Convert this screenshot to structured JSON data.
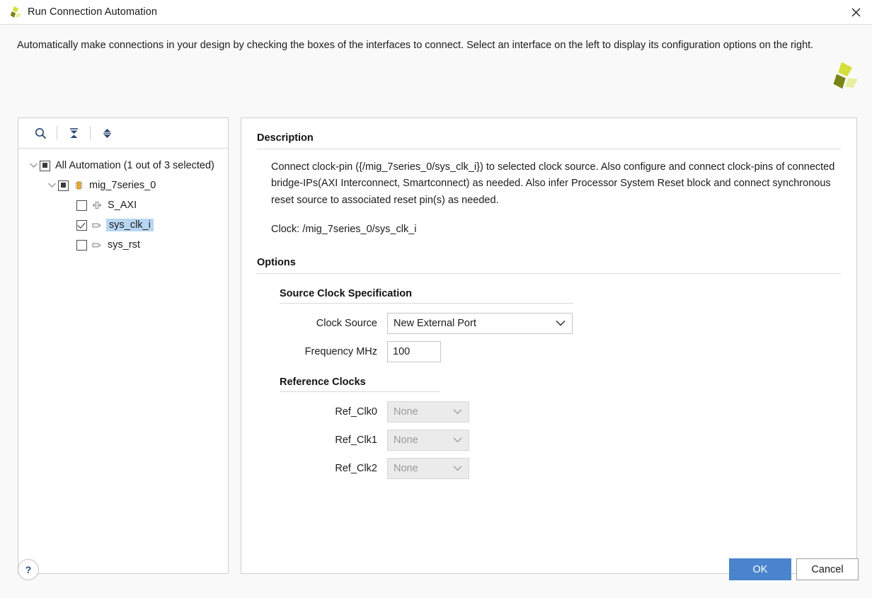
{
  "window": {
    "title": "Run Connection Automation",
    "logo_icon": "vivado-logo-icon",
    "close_icon": "close-icon"
  },
  "intro": {
    "text": "Automatically make connections in your design by checking the boxes of the interfaces to connect. Select an interface on the left to display its configuration options on the right.",
    "logo_icon": "vivado-logo-icon"
  },
  "tree_toolbar": {
    "search_icon": "search-icon",
    "collapse_all_icon": "collapse-all-icon",
    "expand_all_icon": "expand-all-icon"
  },
  "tree": {
    "nodes": [
      {
        "label": "All Automation (1 out of 3 selected)",
        "check_state": "partial",
        "expanded": true,
        "indent": 0,
        "has_twisty": true,
        "icon": "none",
        "selected": false
      },
      {
        "label": "mig_7series_0",
        "check_state": "partial",
        "expanded": true,
        "indent": 1,
        "has_twisty": true,
        "icon": "ip-block-icon",
        "selected": false
      },
      {
        "label": "S_AXI",
        "check_state": "unchecked",
        "expanded": false,
        "indent": 2,
        "has_twisty": false,
        "icon": "bus-interface-icon",
        "selected": false
      },
      {
        "label": "sys_clk_i",
        "check_state": "checked",
        "expanded": false,
        "indent": 2,
        "has_twisty": false,
        "icon": "pin-icon",
        "selected": true
      },
      {
        "label": "sys_rst",
        "check_state": "unchecked",
        "expanded": false,
        "indent": 2,
        "has_twisty": false,
        "icon": "pin-icon",
        "selected": false
      }
    ]
  },
  "description": {
    "heading": "Description",
    "paragraph1": "Connect clock-pin ({/mig_7series_0/sys_clk_i}) to selected clock source. Also configure and connect clock-pins of connected bridge-IPs(AXI Interconnect, Smartconnect) as needed. Also infer Processor System Reset block and connect synchronous reset source to associated reset pin(s) as needed.",
    "paragraph2": "Clock: /mig_7series_0/sys_clk_i"
  },
  "options": {
    "heading": "Options",
    "source_clock": {
      "heading": "Source Clock Specification",
      "clock_source_label": "Clock Source",
      "clock_source_value": "New External Port",
      "frequency_label": "Frequency MHz",
      "frequency_value": "100"
    },
    "reference_clocks": {
      "heading": "Reference Clocks",
      "rows": [
        {
          "label": "Ref_Clk0",
          "value": "None",
          "disabled": true
        },
        {
          "label": "Ref_Clk1",
          "value": "None",
          "disabled": true
        },
        {
          "label": "Ref_Clk2",
          "value": "None",
          "disabled": true
        }
      ]
    }
  },
  "footer": {
    "help_label": "?",
    "ok_label": "OK",
    "cancel_label": "Cancel"
  },
  "colors": {
    "accent_blue": "#4a84cd",
    "selection_blue": "#b8d6f2",
    "logo_dark": "#7a8416",
    "logo_bright": "#d3e03a",
    "logo_pale": "#e7eea0"
  }
}
